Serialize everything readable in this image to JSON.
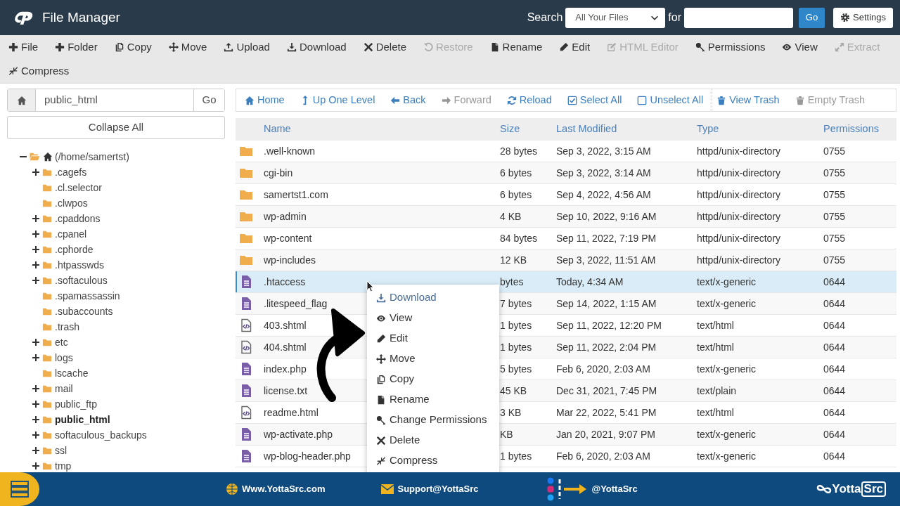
{
  "header": {
    "title": "File Manager",
    "search_label": "Search",
    "scope": "All Your Files",
    "for_label": "for",
    "go": "Go",
    "settings": "Settings"
  },
  "toolbar": [
    {
      "label": "File",
      "disabled": false
    },
    {
      "label": "Folder",
      "disabled": false
    },
    {
      "label": "Copy",
      "disabled": false
    },
    {
      "label": "Move",
      "disabled": false
    },
    {
      "label": "Upload",
      "disabled": false
    },
    {
      "label": "Download",
      "disabled": false
    },
    {
      "label": "Delete",
      "disabled": false
    },
    {
      "label": "Restore",
      "disabled": true
    },
    {
      "label": "Rename",
      "disabled": false
    },
    {
      "label": "Edit",
      "disabled": false
    },
    {
      "label": "HTML Editor",
      "disabled": true
    },
    {
      "label": "Permissions",
      "disabled": false
    },
    {
      "label": "View",
      "disabled": false
    },
    {
      "label": "Extract",
      "disabled": true
    },
    {
      "label": "Compress",
      "disabled": false
    }
  ],
  "path_bar": {
    "value": "public_html",
    "go": "Go"
  },
  "collapse_all": "Collapse All",
  "tree": {
    "label": "(/home/samertst)",
    "expanded": true,
    "children": [
      {
        "label": ".cagefs",
        "expandable": true,
        "selected": false
      },
      {
        "label": ".cl.selector",
        "expandable": false,
        "selected": false
      },
      {
        "label": ".clwpos",
        "expandable": false,
        "selected": false
      },
      {
        "label": ".cpaddons",
        "expandable": true,
        "selected": false
      },
      {
        "label": ".cpanel",
        "expandable": true,
        "selected": false
      },
      {
        "label": ".cphorde",
        "expandable": true,
        "selected": false
      },
      {
        "label": ".htpasswds",
        "expandable": true,
        "selected": false
      },
      {
        "label": ".softaculous",
        "expandable": true,
        "selected": false
      },
      {
        "label": ".spamassassin",
        "expandable": false,
        "selected": false
      },
      {
        "label": ".subaccounts",
        "expandable": false,
        "selected": false
      },
      {
        "label": ".trash",
        "expandable": false,
        "selected": false
      },
      {
        "label": "etc",
        "expandable": true,
        "selected": false
      },
      {
        "label": "logs",
        "expandable": true,
        "selected": false
      },
      {
        "label": "lscache",
        "expandable": false,
        "selected": false
      },
      {
        "label": "mail",
        "expandable": true,
        "selected": false
      },
      {
        "label": "public_ftp",
        "expandable": true,
        "selected": false
      },
      {
        "label": "public_html",
        "expandable": true,
        "selected": true
      },
      {
        "label": "softaculous_backups",
        "expandable": true,
        "selected": false
      },
      {
        "label": "ssl",
        "expandable": true,
        "selected": false
      },
      {
        "label": "tmp",
        "expandable": true,
        "selected": false
      }
    ]
  },
  "nav": [
    {
      "label": "Home",
      "disabled": false
    },
    {
      "label": "Up One Level",
      "disabled": false
    },
    {
      "label": "Back",
      "disabled": false
    },
    {
      "label": "Forward",
      "disabled": true
    },
    {
      "label": "Reload",
      "disabled": false
    },
    {
      "label": "Select All",
      "disabled": false
    },
    {
      "label": "Unselect All",
      "disabled": false
    },
    {
      "label": "View Trash",
      "disabled": false
    },
    {
      "label": "Empty Trash",
      "disabled": true
    }
  ],
  "table": {
    "columns": [
      "Name",
      "Size",
      "Last Modified",
      "Type",
      "Permissions"
    ],
    "rows": [
      {
        "kind": "folder",
        "name": ".well-known",
        "size": "28 bytes",
        "modified": "Sep 3, 2022, 3:15 AM",
        "type": "httpd/unix-directory",
        "perms": "0755",
        "selected": false
      },
      {
        "kind": "folder",
        "name": "cgi-bin",
        "size": "6 bytes",
        "modified": "Sep 3, 2022, 3:14 AM",
        "type": "httpd/unix-directory",
        "perms": "0755",
        "selected": false
      },
      {
        "kind": "folder",
        "name": "samertst1.com",
        "size": "6 bytes",
        "modified": "Sep 4, 2022, 4:56 AM",
        "type": "httpd/unix-directory",
        "perms": "0755",
        "selected": false
      },
      {
        "kind": "folder",
        "name": "wp-admin",
        "size": "4 KB",
        "modified": "Sep 10, 2022, 9:16 AM",
        "type": "httpd/unix-directory",
        "perms": "0755",
        "selected": false
      },
      {
        "kind": "folder",
        "name": "wp-content",
        "size": "84 bytes",
        "modified": "Sep 11, 2022, 7:19 PM",
        "type": "httpd/unix-directory",
        "perms": "0755",
        "selected": false
      },
      {
        "kind": "folder",
        "name": "wp-includes",
        "size": "12 KB",
        "modified": "Sep 3, 2022, 11:51 AM",
        "type": "httpd/unix-directory",
        "perms": "0755",
        "selected": false
      },
      {
        "kind": "text",
        "name": ".htaccess",
        "size": "bytes",
        "modified": "Today, 4:34 AM",
        "type": "text/x-generic",
        "perms": "0644",
        "selected": true
      },
      {
        "kind": "text",
        "name": ".litespeed_flag",
        "size": "7 bytes",
        "modified": "Sep 14, 2022, 1:15 AM",
        "type": "text/x-generic",
        "perms": "0644",
        "selected": false
      },
      {
        "kind": "code",
        "name": "403.shtml",
        "size": "1 bytes",
        "modified": "Sep 11, 2022, 12:20 PM",
        "type": "text/html",
        "perms": "0644",
        "selected": false
      },
      {
        "kind": "code",
        "name": "404.shtml",
        "size": "1 bytes",
        "modified": "Sep 11, 2022, 2:04 PM",
        "type": "text/html",
        "perms": "0644",
        "selected": false
      },
      {
        "kind": "text",
        "name": "index.php",
        "size": "5 bytes",
        "modified": "Feb 6, 2020, 2:03 AM",
        "type": "text/x-generic",
        "perms": "0644",
        "selected": false
      },
      {
        "kind": "text",
        "name": "license.txt",
        "size": "45 KB",
        "modified": "Dec 31, 2021, 7:45 PM",
        "type": "text/plain",
        "perms": "0644",
        "selected": false
      },
      {
        "kind": "code",
        "name": "readme.html",
        "size": "3 KB",
        "modified": "Mar 22, 2022, 5:41 PM",
        "type": "text/html",
        "perms": "0644",
        "selected": false
      },
      {
        "kind": "text",
        "name": "wp-activate.php",
        "size": "KB",
        "modified": "Jan 20, 2021, 9:07 PM",
        "type": "text/x-generic",
        "perms": "0644",
        "selected": false
      },
      {
        "kind": "text",
        "name": "wp-blog-header.php",
        "size": "1 bytes",
        "modified": "Feb 6, 2020, 2:03 AM",
        "type": "text/x-generic",
        "perms": "0644",
        "selected": false
      }
    ]
  },
  "context_menu": [
    "Download",
    "View",
    "Edit",
    "Move",
    "Copy",
    "Rename",
    "Change Permissions",
    "Delete",
    "Compress"
  ],
  "footer": {
    "website": "Www.YottaSrc.com",
    "email": "Support@YottaSrc",
    "handle": "@YottaSrc",
    "logo": [
      "Yotta",
      "Src"
    ]
  }
}
